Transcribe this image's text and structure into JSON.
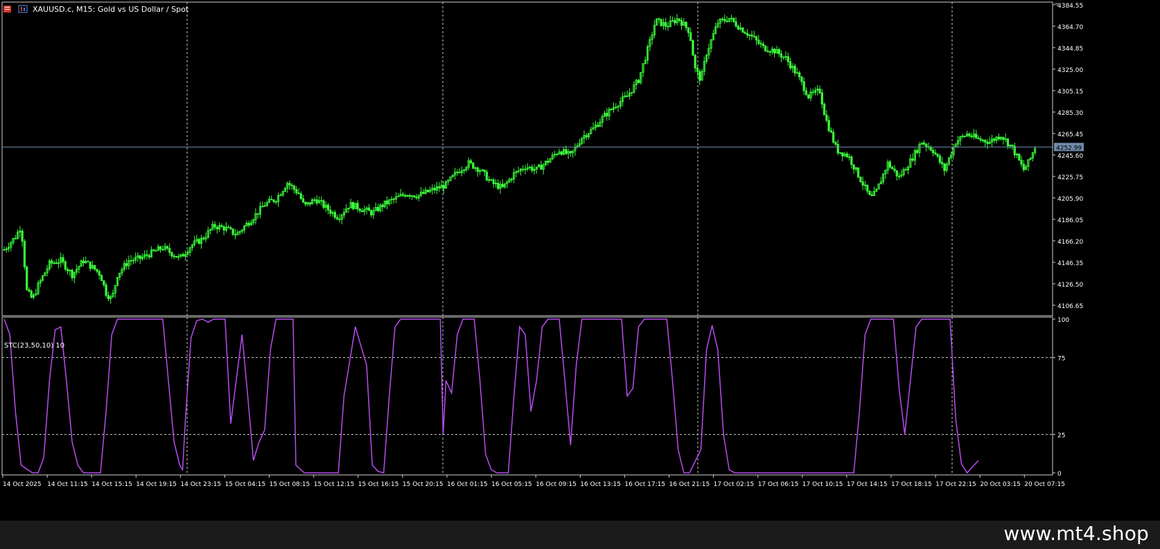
{
  "symbol_title": "XAUUSD.c, M15:  Gold vs US Dollar / Spot",
  "indicator_title": "STC(23,50,10) 10",
  "current_price": "4252.99",
  "watermark": "www.mt4.shop",
  "colors": {
    "background": "#000000",
    "candle": "#3cff3c",
    "stc_line": "#b84df0",
    "grid": "#c8c8c8",
    "axis_text": "#ffffff",
    "price_line": "#6e8aa8",
    "price_tag": "#6e8aa8"
  },
  "price_axis": {
    "ticks": [
      "4384.55",
      "4364.70",
      "4344.85",
      "4325.00",
      "4305.15",
      "4285.30",
      "4265.45",
      "4245.60",
      "4225.75",
      "4205.90",
      "4186.05",
      "4166.20",
      "4146.35",
      "4126.50",
      "4106.65"
    ],
    "range": [
      4097,
      4387
    ]
  },
  "stc_axis": {
    "ticks": [
      "100",
      "75",
      "25",
      "0"
    ],
    "range": [
      0,
      100
    ]
  },
  "time_axis": {
    "labels": [
      "14 Oct 2025",
      "14 Oct 11:15",
      "14 Oct 15:15",
      "14 Oct 19:15",
      "14 Oct 23:15",
      "15 Oct 04:15",
      "15 Oct 08:15",
      "15 Oct 12:15",
      "15 Oct 16:15",
      "15 Oct 20:15",
      "16 Oct 01:15",
      "16 Oct 05:15",
      "16 Oct 09:15",
      "16 Oct 13:15",
      "16 Oct 17:15",
      "16 Oct 21:15",
      "17 Oct 02:15",
      "17 Oct 06:15",
      "17 Oct 10:15",
      "17 Oct 14:15",
      "17 Oct 18:15",
      "17 Oct 22:15",
      "20 Oct 03:15",
      "20 Oct 07:15"
    ]
  },
  "chart_data": [
    {
      "type": "candlestick",
      "title": "XAUUSD.c, M15:  Gold vs US Dollar / Spot",
      "ylim": [
        4097,
        4387
      ],
      "price_path": [
        [
          0,
          4158
        ],
        [
          2,
          4170
        ],
        [
          3,
          4180
        ],
        [
          4,
          4120
        ],
        [
          5,
          4112
        ],
        [
          6,
          4125
        ],
        [
          8,
          4145
        ],
        [
          10,
          4148
        ],
        [
          12,
          4135
        ],
        [
          14,
          4148
        ],
        [
          16,
          4140
        ],
        [
          17,
          4135
        ],
        [
          18,
          4118
        ],
        [
          19,
          4112
        ],
        [
          20,
          4135
        ],
        [
          22,
          4148
        ],
        [
          24,
          4150
        ],
        [
          26,
          4155
        ],
        [
          28,
          4160
        ],
        [
          31,
          4150
        ],
        [
          33,
          4162
        ],
        [
          35,
          4168
        ],
        [
          37,
          4180
        ],
        [
          39,
          4178
        ],
        [
          41,
          4172
        ],
        [
          44,
          4188
        ],
        [
          46,
          4200
        ],
        [
          48,
          4205
        ],
        [
          50,
          4220
        ],
        [
          52,
          4210
        ],
        [
          53,
          4198
        ],
        [
          55,
          4205
        ],
        [
          57,
          4196
        ],
        [
          59,
          4188
        ],
        [
          61,
          4200
        ],
        [
          63,
          4196
        ],
        [
          65,
          4192
        ],
        [
          67,
          4200
        ],
        [
          69,
          4205
        ],
        [
          71,
          4210
        ],
        [
          73,
          4208
        ],
        [
          75,
          4212
        ],
        [
          78,
          4218
        ],
        [
          80,
          4230
        ],
        [
          82,
          4238
        ],
        [
          84,
          4232
        ],
        [
          86,
          4220
        ],
        [
          88,
          4215
        ],
        [
          90,
          4228
        ],
        [
          92,
          4235
        ],
        [
          94,
          4232
        ],
        [
          96,
          4240
        ],
        [
          98,
          4250
        ],
        [
          100,
          4245
        ],
        [
          102,
          4262
        ],
        [
          104,
          4270
        ],
        [
          106,
          4282
        ],
        [
          108,
          4292
        ],
        [
          110,
          4300
        ],
        [
          112,
          4315
        ],
        [
          114,
          4350
        ],
        [
          115,
          4370
        ],
        [
          117,
          4365
        ],
        [
          119,
          4372
        ],
        [
          121,
          4360
        ],
        [
          122,
          4325
        ],
        [
          123,
          4315
        ],
        [
          124,
          4340
        ],
        [
          126,
          4368
        ],
        [
          128,
          4372
        ],
        [
          130,
          4363
        ],
        [
          132,
          4355
        ],
        [
          134,
          4345
        ],
        [
          136,
          4342
        ],
        [
          138,
          4335
        ],
        [
          140,
          4320
        ],
        [
          142,
          4300
        ],
        [
          144,
          4305
        ],
        [
          145,
          4280
        ],
        [
          147,
          4250
        ],
        [
          149,
          4245
        ],
        [
          151,
          4225
        ],
        [
          153,
          4205
        ],
        [
          154,
          4212
        ],
        [
          156,
          4238
        ],
        [
          158,
          4225
        ],
        [
          160,
          4240
        ],
        [
          162,
          4258
        ],
        [
          164,
          4250
        ],
        [
          166,
          4232
        ],
        [
          168,
          4258
        ],
        [
          170,
          4265
        ],
        [
          172,
          4260
        ],
        [
          174,
          4258
        ],
        [
          176,
          4264
        ],
        [
          178,
          4252
        ],
        [
          180,
          4232
        ],
        [
          181,
          4240
        ],
        [
          182,
          4253
        ]
      ]
    },
    {
      "type": "line",
      "title": "STC(23,50,10) 10",
      "ylim": [
        0,
        100
      ],
      "series": [
        {
          "values": [
            [
              0,
              100
            ],
            [
              1,
              90
            ],
            [
              2,
              40
            ],
            [
              3,
              5
            ],
            [
              5,
              0
            ],
            [
              6,
              0
            ],
            [
              7,
              10
            ],
            [
              8,
              60
            ],
            [
              9,
              93
            ],
            [
              10,
              95
            ],
            [
              11,
              60
            ],
            [
              12,
              20
            ],
            [
              13,
              5
            ],
            [
              14,
              0
            ],
            [
              16,
              0
            ],
            [
              17,
              0
            ],
            [
              18,
              40
            ],
            [
              19,
              90
            ],
            [
              20,
              100
            ],
            [
              22,
              100
            ],
            [
              27,
              100
            ],
            [
              28,
              100
            ],
            [
              29,
              60
            ],
            [
              30,
              20
            ],
            [
              31,
              5
            ],
            [
              31.5,
              2
            ],
            [
              32,
              35
            ],
            [
              33,
              88
            ],
            [
              34,
              99
            ],
            [
              35,
              100
            ],
            [
              36,
              98
            ],
            [
              37,
              100
            ],
            [
              38,
              100
            ],
            [
              39,
              100
            ],
            [
              40,
              32
            ],
            [
              42,
              90
            ],
            [
              43,
              50
            ],
            [
              44,
              8
            ],
            [
              45,
              20
            ],
            [
              46,
              28
            ],
            [
              47,
              80
            ],
            [
              48,
              100
            ],
            [
              51,
              100
            ],
            [
              51.5,
              5
            ],
            [
              53,
              0
            ],
            [
              59,
              0
            ],
            [
              60,
              50
            ],
            [
              62,
              95
            ],
            [
              64,
              70
            ],
            [
              65,
              5
            ],
            [
              66,
              1
            ],
            [
              67,
              0
            ],
            [
              68,
              50
            ],
            [
              69,
              95
            ],
            [
              70,
              100
            ],
            [
              75,
              100
            ],
            [
              77,
              100
            ],
            [
              77.5,
              25
            ],
            [
              78,
              60
            ],
            [
              79,
              52
            ],
            [
              80,
              90
            ],
            [
              81,
              100
            ],
            [
              83,
              100
            ],
            [
              84,
              60
            ],
            [
              85,
              12
            ],
            [
              86,
              2
            ],
            [
              87,
              0
            ],
            [
              89,
              0
            ],
            [
              90,
              50
            ],
            [
              91,
              95
            ],
            [
              92,
              90
            ],
            [
              93,
              40
            ],
            [
              94,
              60
            ],
            [
              95,
              95
            ],
            [
              96,
              100
            ],
            [
              98,
              100
            ],
            [
              99,
              60
            ],
            [
              100,
              18
            ],
            [
              101,
              70
            ],
            [
              102,
              100
            ],
            [
              104,
              100
            ],
            [
              109,
              100
            ],
            [
              110,
              50
            ],
            [
              111,
              55
            ],
            [
              112,
              95
            ],
            [
              113,
              100
            ],
            [
              115,
              100
            ],
            [
              117,
              100
            ],
            [
              118,
              60
            ],
            [
              119,
              15
            ],
            [
              120,
              0
            ],
            [
              121,
              0
            ],
            [
              123,
              15
            ],
            [
              124,
              80
            ],
            [
              125,
              96
            ],
            [
              126,
              80
            ],
            [
              127,
              25
            ],
            [
              128,
              2
            ],
            [
              129,
              0
            ],
            [
              150,
              0
            ],
            [
              151,
              40
            ],
            [
              152,
              90
            ],
            [
              153,
              100
            ],
            [
              155,
              100
            ],
            [
              157,
              100
            ],
            [
              158,
              55
            ],
            [
              159,
              25
            ],
            [
              160,
              60
            ],
            [
              161,
              95
            ],
            [
              162,
              100
            ],
            [
              164,
              100
            ],
            [
              167,
              100
            ],
            [
              168,
              35
            ],
            [
              169,
              6
            ],
            [
              170,
              0
            ],
            [
              171,
              4
            ],
            [
              172,
              8
            ]
          ]
        }
      ]
    }
  ]
}
